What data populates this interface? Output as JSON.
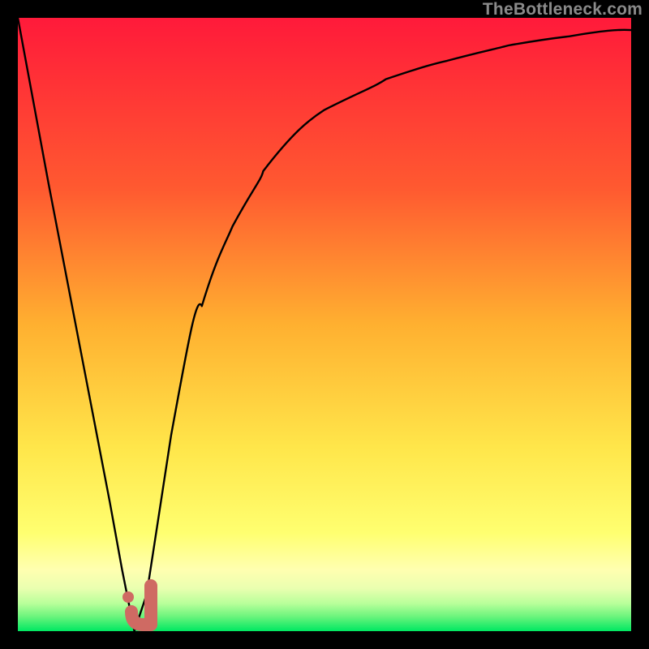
{
  "watermark": {
    "text": "TheBottleneck.com"
  },
  "colors": {
    "black": "#000000",
    "red": "#ff1a3a",
    "orange": "#ff8a2a",
    "yellow": "#ffe64a",
    "paleYellow": "#ffff9a",
    "green": "#00e862",
    "curve": "#000000",
    "hook": "#cf6a63"
  },
  "chart_data": {
    "type": "line",
    "title": "",
    "xlabel": "",
    "ylabel": "",
    "xlim": [
      0,
      100
    ],
    "ylim": [
      0,
      100
    ],
    "grid": false,
    "legend": false,
    "series": [
      {
        "name": "bottleneck-curve",
        "x": [
          0,
          5,
          10,
          15,
          17,
          19,
          21,
          23,
          25,
          30,
          35,
          40,
          50,
          60,
          70,
          80,
          90,
          100
        ],
        "values": [
          100,
          73,
          47,
          21,
          10,
          0,
          6,
          19,
          32,
          53,
          66,
          75,
          85,
          90,
          93,
          95.5,
          97,
          98
        ]
      }
    ],
    "annotations": [
      {
        "name": "optimal-hook",
        "type": "marker",
        "shape": "J",
        "x_range": [
          17.5,
          22.5
        ],
        "y_range": [
          0,
          8
        ],
        "color": "#cf6a63"
      }
    ]
  }
}
